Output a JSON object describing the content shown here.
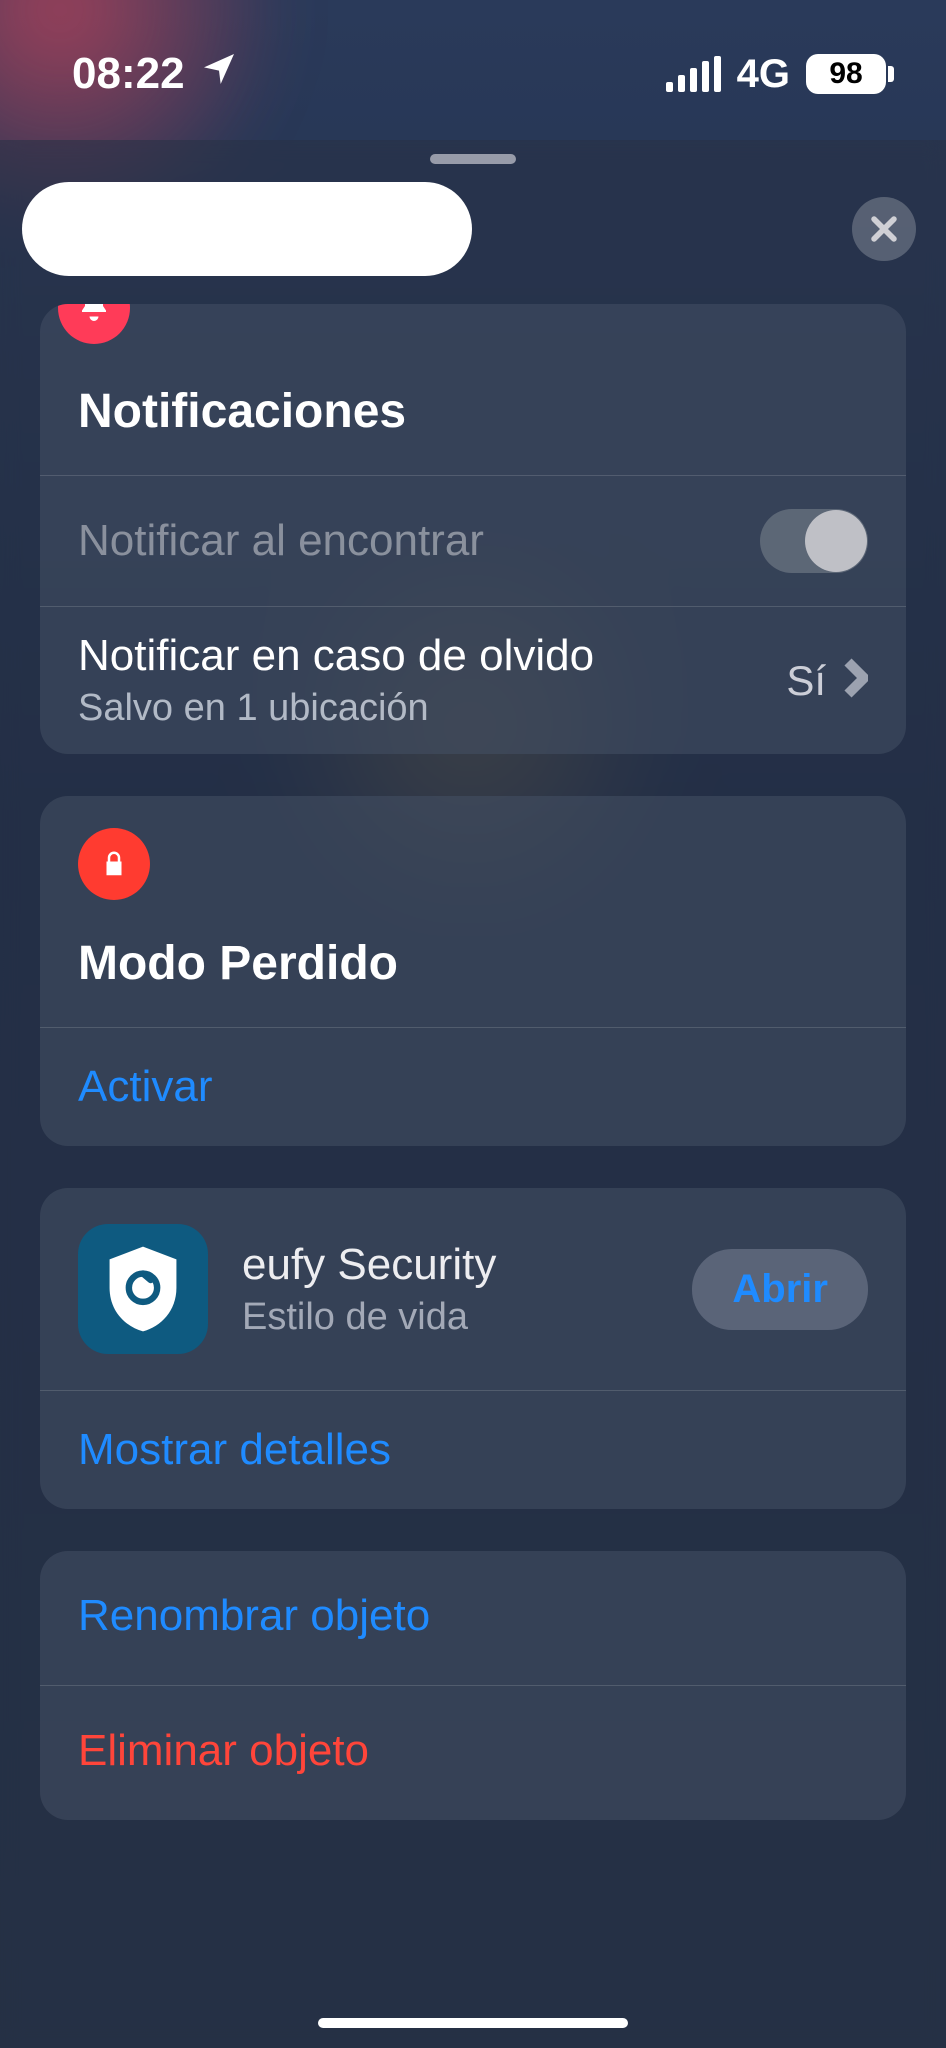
{
  "status": {
    "time": "08:22",
    "network": "4G",
    "battery": "98"
  },
  "notifications": {
    "title": "Notificaciones",
    "notify_found_label": "Notificar al encontrar",
    "notify_left": {
      "label": "Notificar en caso de olvido",
      "sub": "Salvo en 1 ubicación",
      "value": "Sí"
    }
  },
  "lost_mode": {
    "title": "Modo Perdido",
    "activate": "Activar"
  },
  "app": {
    "name": "eufy Security",
    "category": "Estilo de vida",
    "open": "Abrir",
    "details": "Mostrar detalles"
  },
  "actions": {
    "rename": "Renombrar objeto",
    "delete": "Eliminar objeto"
  }
}
